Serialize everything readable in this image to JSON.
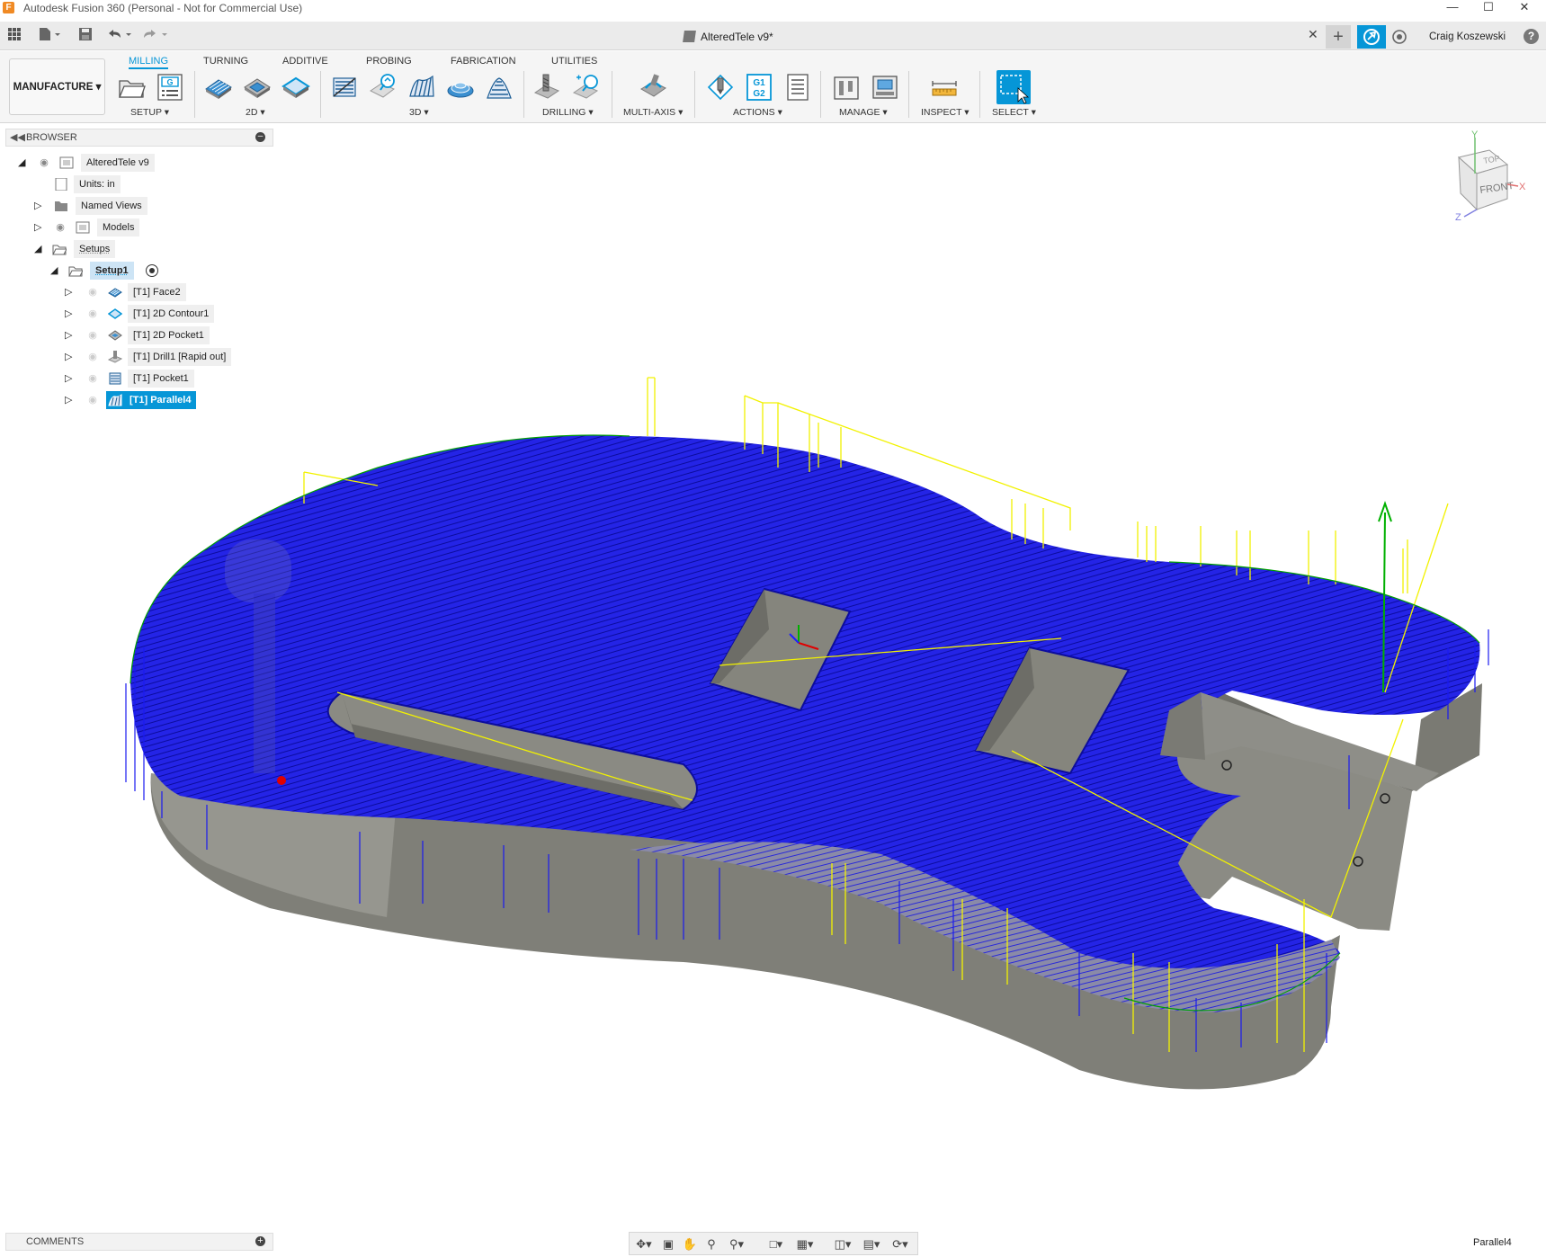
{
  "window": {
    "title": "Autodesk Fusion 360 (Personal - Not for Commercial Use)",
    "app_icon": "F",
    "controls": [
      "minimize-icon",
      "maximize-icon",
      "close-icon"
    ]
  },
  "quick_access": {
    "document_tab": "AlteredTele v9*",
    "user_name": "Craig Koszewski",
    "icons": [
      "grid-icon",
      "file-icon",
      "save-icon",
      "undo-icon",
      "redo-icon",
      "close-icon",
      "plus-icon",
      "job-status-icon",
      "clock-icon",
      "help-icon"
    ]
  },
  "ribbon": {
    "workspace": "MANUFACTURE",
    "tabs": [
      {
        "label": "MILLING",
        "active": true
      },
      {
        "label": "TURNING",
        "active": false
      },
      {
        "label": "ADDITIVE",
        "active": false
      },
      {
        "label": "PROBING",
        "active": false
      },
      {
        "label": "FABRICATION",
        "active": false
      },
      {
        "label": "UTILITIES",
        "active": false
      }
    ],
    "groups": [
      {
        "label": "SETUP"
      },
      {
        "label": "2D"
      },
      {
        "label": "3D"
      },
      {
        "label": "DRILLING"
      },
      {
        "label": "MULTI-AXIS"
      },
      {
        "label": "ACTIONS"
      },
      {
        "label": "MANAGE"
      },
      {
        "label": "INSPECT"
      },
      {
        "label": "SELECT"
      }
    ],
    "actions_icon_text": [
      "G1",
      "G2"
    ],
    "setup_icon_text": "G"
  },
  "browser": {
    "title": "BROWSER",
    "root": "AlteredTele v9",
    "units": "Units: in",
    "named_views": "Named Views",
    "models": "Models",
    "setups": "Setups",
    "setup1": "Setup1",
    "operations": [
      {
        "label": "[T1] Face2",
        "icon": "face-op-icon",
        "selected": false
      },
      {
        "label": "[T1] 2D Contour1",
        "icon": "contour-op-icon",
        "selected": false
      },
      {
        "label": "[T1] 2D Pocket1",
        "icon": "pocket-op-icon",
        "selected": false
      },
      {
        "label": "[T1] Drill1 [Rapid out]",
        "icon": "drill-op-icon",
        "selected": false
      },
      {
        "label": "[T1] Pocket1",
        "icon": "pocket3d-op-icon",
        "selected": false
      },
      {
        "label": "[T1] Parallel4",
        "icon": "parallel-op-icon",
        "selected": true
      }
    ]
  },
  "viewcube": {
    "top": "TOP",
    "front": "FRONT",
    "axis_x": "X",
    "axis_y": "Y",
    "axis_z": "Z"
  },
  "colors": {
    "accent": "#0696d7",
    "toolpath": "#1a1af0",
    "stock": "#8a8a84",
    "rapid": "#f0f000",
    "lead": "#00a000"
  },
  "bottom": {
    "comments": "COMMENTS",
    "status_right": "Parallel4",
    "nav_icons": [
      "orbit-icon",
      "look-at-icon",
      "pan-icon",
      "zoom-icon",
      "fit-icon",
      "display-settings-icon",
      "grid-settings-icon",
      "viewports-icon",
      "camera-icon",
      "rotate-icon"
    ]
  }
}
